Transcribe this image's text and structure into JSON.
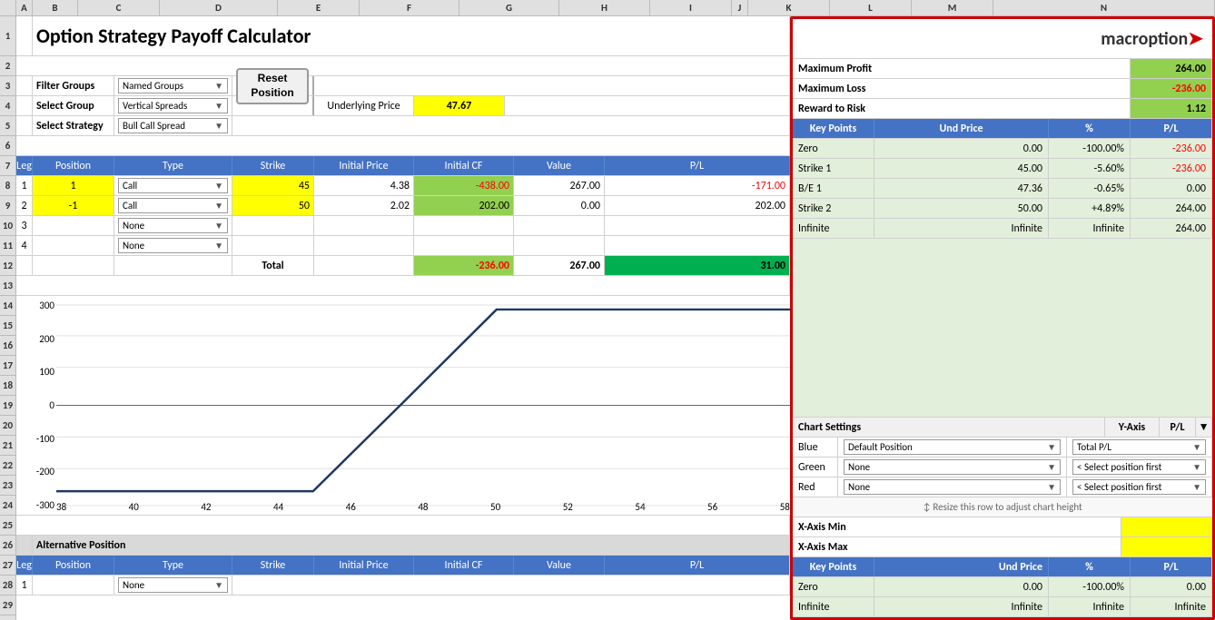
{
  "app": {
    "title": "Option Strategy Payoff Calculator",
    "logo": "macroption",
    "logo_arrow": "➤"
  },
  "col_headers": [
    "A",
    "B",
    "C",
    "D",
    "E",
    "F",
    "G",
    "H",
    "I",
    "J",
    "K",
    "L",
    "M",
    "N"
  ],
  "row_numbers": [
    "1",
    "2",
    "3",
    "4",
    "5",
    "6",
    "7",
    "8",
    "9",
    "10",
    "11",
    "12",
    "13",
    "14",
    "15",
    "16",
    "17",
    "18",
    "19",
    "20",
    "21",
    "22",
    "23",
    "24",
    "25",
    "26",
    "27",
    "28",
    "29"
  ],
  "filter": {
    "groups_label": "Filter Groups",
    "group_label": "Select Group",
    "strategy_label": "Select Strategy",
    "groups_value": "Named Groups",
    "group_value": "Vertical Spreads",
    "strategy_value": "Bull Call Spread"
  },
  "reset_btn": "Reset\nPosition",
  "underlying_label": "Underlying Price",
  "underlying_price": "47.67",
  "legs_headers": {
    "leg": "Leg",
    "position": "Position",
    "type": "Type",
    "strike": "Strike",
    "initial_price": "Initial Price",
    "initial_cf": "Initial CF",
    "value": "Value",
    "pl": "P/L"
  },
  "legs": [
    {
      "leg": "1",
      "position": "1",
      "type": "Call",
      "strike": "45",
      "initial_price": "4.38",
      "initial_cf": "-438.00",
      "value": "267.00",
      "pl": "-171.00"
    },
    {
      "leg": "2",
      "position": "-1",
      "type": "Call",
      "strike": "50",
      "initial_price": "2.02",
      "initial_cf": "202.00",
      "value": "0.00",
      "pl": "202.00"
    },
    {
      "leg": "3",
      "position": "",
      "type": "None",
      "strike": "",
      "initial_price": "",
      "initial_cf": "",
      "value": "",
      "pl": ""
    },
    {
      "leg": "4",
      "position": "",
      "type": "None",
      "strike": "",
      "initial_price": "",
      "initial_cf": "",
      "value": "",
      "pl": ""
    }
  ],
  "totals": {
    "label": "Total",
    "initial_cf": "-236.00",
    "value": "267.00",
    "pl": "31.00"
  },
  "chart": {
    "x_min": 38,
    "x_max": 58,
    "y_min": -300,
    "y_max": 300,
    "x_ticks": [
      38,
      40,
      42,
      44,
      46,
      48,
      50,
      52,
      54,
      56,
      58
    ],
    "y_ticks": [
      300,
      200,
      100,
      0,
      -100,
      -200,
      -300
    ],
    "x_axis_min_label": "X-Axis Min",
    "x_axis_max_label": "X-Axis Max"
  },
  "right_panel": {
    "max_profit_label": "Maximum Profit",
    "max_profit_value": "264.00",
    "max_loss_label": "Maximum Loss",
    "max_loss_value": "-236.00",
    "reward_risk_label": "Reward to Risk",
    "reward_risk_value": "1.12",
    "key_points_headers": {
      "key_points": "Key Points",
      "und_price": "Und Price",
      "pct": "%",
      "pl": "P/L"
    },
    "key_points": [
      {
        "label": "Zero",
        "und_price": "0.00",
        "pct": "-100.00%",
        "pl": "-236.00"
      },
      {
        "label": "Strike 1",
        "und_price": "45.00",
        "pct": "-5.60%",
        "pl": "-236.00"
      },
      {
        "label": "B/E 1",
        "und_price": "47.36",
        "pct": "-0.65%",
        "pl": "0.00"
      },
      {
        "label": "Strike 2",
        "und_price": "50.00",
        "pct": "+4.89%",
        "pl": "264.00"
      },
      {
        "label": "Infinite",
        "und_price": "Infinite",
        "pct": "Infinite",
        "pl": "264.00"
      }
    ],
    "chart_settings": {
      "label": "Chart Settings",
      "y_axis_label": "Y-Axis",
      "pl_label": "P/L",
      "rows": [
        {
          "color_label": "Blue",
          "position_value": "Default Position",
          "y_axis_value": "Total P/L"
        },
        {
          "color_label": "Green",
          "position_value": "None",
          "y_axis_value": "< Select position first"
        },
        {
          "color_label": "Red",
          "position_value": "None",
          "y_axis_value": "< Select position first"
        }
      ]
    },
    "resize_hint": "↕ Resize this row to adjust chart height",
    "x_axis_min": "X-Axis Min",
    "x_axis_max": "X-Axis Max",
    "bottom_key_points": {
      "headers": {
        "key_points": "Key Points",
        "und_price": "Und Price",
        "pct": "%",
        "pl": "P/L"
      },
      "rows": [
        {
          "label": "Zero",
          "und_price": "0.00",
          "pct": "-100.00%",
          "pl": "0.00"
        },
        {
          "label": "Infinite",
          "und_price": "Infinite",
          "pct": "Infinite",
          "pl": "Infinite"
        }
      ]
    }
  },
  "alt_position": {
    "label": "Alternative Position",
    "headers": {
      "leg": "Leg",
      "position": "Position",
      "type": "Type",
      "strike": "Strike",
      "initial_price": "Initial Price",
      "initial_cf": "Initial CF",
      "value": "Value",
      "pl": "P/L"
    },
    "rows": [
      {
        "leg": "1",
        "type": "None"
      }
    ]
  }
}
